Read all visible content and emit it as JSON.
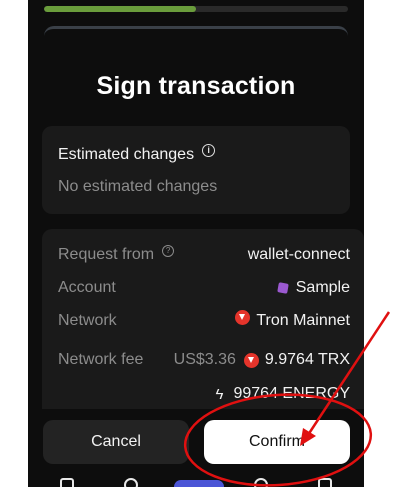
{
  "colors": {
    "background": "#0d0d0d",
    "card": "#1a1a1a",
    "muted_text": "#8c8c8c",
    "progress": "#6a9d3c",
    "tron_red": "#e5342b",
    "annotation_red": "#e01010"
  },
  "progress": {
    "fraction": 0.5
  },
  "title": "Sign transaction",
  "estimated": {
    "heading": "Estimated changes",
    "info_icon": "info-icon",
    "empty_text": "No estimated changes"
  },
  "request": {
    "from_label": "Request from",
    "from_value": "wallet-connect",
    "account_label": "Account",
    "account_value": "Sample",
    "network_label": "Network",
    "network_value": "Tron Mainnet",
    "fee_label": "Network fee",
    "fee_usd": "US$3.36",
    "fee_trx": "9.9764 TRX",
    "fee_energy": "99764 ENERGY"
  },
  "buttons": {
    "cancel": "Cancel",
    "confirm": "Confirm"
  }
}
